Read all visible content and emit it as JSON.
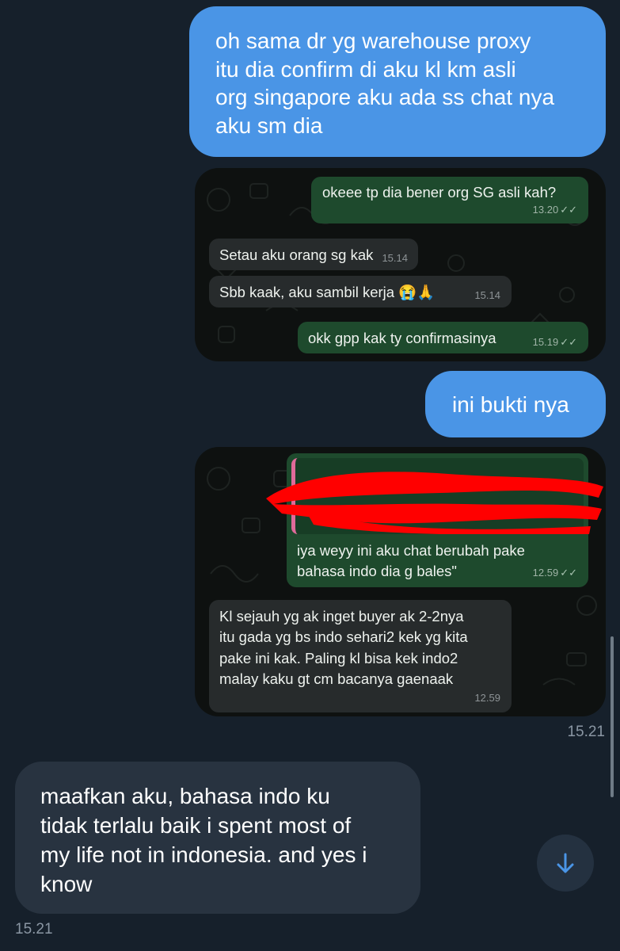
{
  "messages": {
    "m1": {
      "lines": [
        "oh sama dr yg warehouse proxy",
        "itu dia confirm di aku kl km asli",
        "org singapore aku ada ss chat nya",
        "aku sm dia"
      ]
    },
    "m2": {
      "text": "ini bukti nya"
    },
    "m3": {
      "lines": [
        "maafkan aku, bahasa indo ku",
        "tidak terlalu baik i spent most of",
        "my life not in indonesia. and yes i",
        "know"
      ]
    }
  },
  "screenshot1": {
    "b1": {
      "text": "okeee tp dia bener org SG asli kah?",
      "time": "13.20"
    },
    "b2": {
      "text": "Setau aku orang sg kak",
      "time": "15.14"
    },
    "b3": {
      "text": "Sbb kaak, aku sambil kerja 😭🙏",
      "time": "15.14"
    },
    "b4": {
      "text": "okk gpp kak ty confirmasinya",
      "time": "15.19"
    }
  },
  "screenshot2": {
    "b1": {
      "lines": [
        "iya weyy ini aku chat berubah pake",
        "bahasa indo dia g bales\""
      ],
      "time": "12.59"
    },
    "b2": {
      "lines": [
        "Kl sejauh yg ak inget buyer ak 2-2nya",
        "itu gada yg bs indo sehari2 kek yg kita",
        "pake ini kak. Paling kl bisa kek indo2",
        "malay kaku gt cm bacanya gaenaak"
      ],
      "time": "12.59"
    }
  },
  "timestamps": {
    "t1": "15.21",
    "t2": "15.21"
  },
  "icons": {
    "scroll_down": "arrow-down-icon",
    "read_ticks": "double-check-icon"
  },
  "colors": {
    "background": "#16202b",
    "outgoing": "#4a95e6",
    "incoming": "#283340",
    "wa_outgoing": "#1e4a2d"
  }
}
